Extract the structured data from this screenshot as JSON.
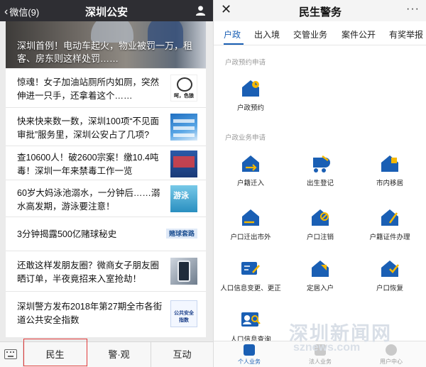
{
  "left": {
    "topbar": {
      "back_label": "微信(9)",
      "title": "深圳公安"
    },
    "hero": {
      "caption": "深圳首例！电动车起火，物业被罚一万，租客、房东则这样处罚……"
    },
    "news": [
      {
        "text": "惊魂！女子加油站厕所内如厕，突然伸进一只手，还拿着这个……",
        "thumb": "bear",
        "thumb_caption": "呵，色狼"
      },
      {
        "text": "快来快来数一数，深圳100项“不见面审批”服务里，深圳公安占了几项?",
        "thumb": "blue"
      },
      {
        "text": "查10600人！破2600宗案！缴10.4吨毒！深圳一年来禁毒工作一览",
        "thumb": "drug"
      },
      {
        "text": "60岁大妈泳池溺水，一分钟后……溺水高发期，游泳要注意！",
        "thumb": "swim",
        "thumb_caption": "游泳"
      },
      {
        "text": "3分钟揭露500亿赌球秘史",
        "thumb": "tag",
        "thumb_caption": "赌球套路"
      },
      {
        "text": "还敢这样发朋友圈？微商女子朋友圈晒订单，半夜竟招来入室抢劫！",
        "thumb": "phone"
      },
      {
        "text": "深圳警方发布2018年第27期全市各街道公共安全指数",
        "thumb": "report",
        "thumb_caption": "公共安全指数"
      }
    ],
    "bottom_menu": [
      "民生",
      "警·观",
      "互动"
    ]
  },
  "right": {
    "topbar": {
      "close_label": "✕",
      "title": "民生警务",
      "more_label": "···"
    },
    "tabs": [
      "户政",
      "出入境",
      "交管业务",
      "案件公开",
      "有奖举报"
    ],
    "active_tab": 0,
    "sections": [
      {
        "title": "户政预约申请",
        "items": [
          "户政预约"
        ]
      },
      {
        "title": "户政业务申请",
        "items": [
          "户籍迁入",
          "出生登记",
          "市内移居",
          "户口迁出市外",
          "户口注销",
          "户籍证件办理",
          "人口信息变更、更正",
          "定居入户",
          "户口恢复",
          "人口信息查询"
        ]
      }
    ],
    "bottom_tabs": [
      "个人业务",
      "法人业务",
      "用户中心"
    ],
    "active_bottom_tab": 0
  },
  "watermark": {
    "line1": "深圳新闻网",
    "line2": "sznews.com"
  },
  "colors": {
    "accent": "#1a5fb4",
    "icon_yellow": "#f5b800",
    "highlight": "#e23a3a",
    "wechat_bar": "#2e2e33"
  }
}
